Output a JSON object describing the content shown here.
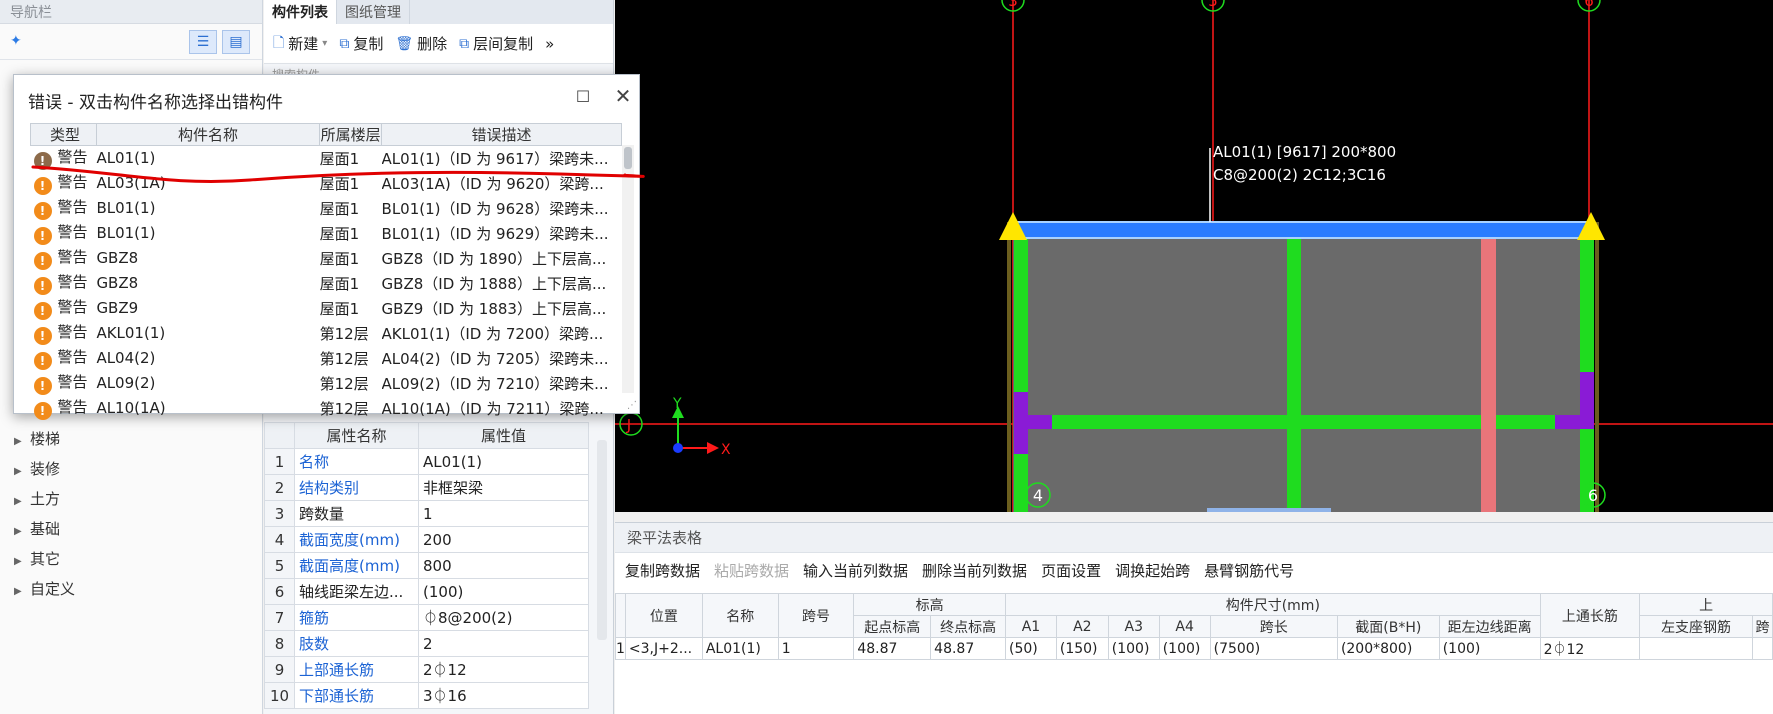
{
  "nav": {
    "title": "导航栏",
    "tree": [
      "楼梯",
      "装修",
      "土方",
      "基础",
      "其它",
      "自定义"
    ]
  },
  "mid": {
    "tabs": [
      "构件列表",
      "图纸管理"
    ],
    "actions": [
      "新建",
      "复制",
      "删除",
      "层间复制"
    ],
    "search_placeholder": "搜索构件...",
    "props_headers": [
      "属性名称",
      "属性值"
    ],
    "props": [
      {
        "no": "1",
        "key": "名称",
        "val": "AL01(1)",
        "blue": true
      },
      {
        "no": "2",
        "key": "结构类别",
        "val": "非框架梁",
        "blue": true
      },
      {
        "no": "3",
        "key": "跨数量",
        "val": "1",
        "blue": false
      },
      {
        "no": "4",
        "key": "截面宽度(mm)",
        "val": "200",
        "blue": true
      },
      {
        "no": "5",
        "key": "截面高度(mm)",
        "val": "800",
        "blue": true
      },
      {
        "no": "6",
        "key": "轴线距梁左边...",
        "val": "(100)",
        "blue": false
      },
      {
        "no": "7",
        "key": "箍筋",
        "val": "⏀8@200(2)",
        "blue": true
      },
      {
        "no": "8",
        "key": "肢数",
        "val": "2",
        "blue": true
      },
      {
        "no": "9",
        "key": "上部通长筋",
        "val": "2⏀12",
        "blue": true
      },
      {
        "no": "10",
        "key": "下部通长筋",
        "val": "3⏀16",
        "blue": true
      }
    ]
  },
  "dialog": {
    "title": "错误 - 双击构件名称选择出错构件",
    "headers": [
      "类型",
      "构件名称",
      "所属楼层",
      "错误描述"
    ],
    "rows": [
      {
        "type": "警告",
        "name": "AL01(1)",
        "floor": "屋面1",
        "desc": "AL01(1)（ID 为 9617）梁跨未..."
      },
      {
        "type": "警告",
        "name": "AL03(1A)",
        "floor": "屋面1",
        "desc": "AL03(1A)（ID 为 9620）梁跨..."
      },
      {
        "type": "警告",
        "name": "BL01(1)",
        "floor": "屋面1",
        "desc": "BL01(1)（ID 为 9628）梁跨未..."
      },
      {
        "type": "警告",
        "name": "BL01(1)",
        "floor": "屋面1",
        "desc": "BL01(1)（ID 为 9629）梁跨未..."
      },
      {
        "type": "警告",
        "name": "GBZ8",
        "floor": "屋面1",
        "desc": "GBZ8（ID 为 1890）上下层高..."
      },
      {
        "type": "警告",
        "name": "GBZ8",
        "floor": "屋面1",
        "desc": "GBZ8（ID 为 1888）上下层高..."
      },
      {
        "type": "警告",
        "name": "GBZ9",
        "floor": "屋面1",
        "desc": "GBZ9（ID 为 1883）上下层高..."
      },
      {
        "type": "警告",
        "name": "AKL01(1)",
        "floor": "第12层",
        "desc": "AKL01(1)（ID 为 7200）梁跨..."
      },
      {
        "type": "警告",
        "name": "AL04(2)",
        "floor": "第12层",
        "desc": "AL04(2)（ID 为 7205）梁跨未..."
      },
      {
        "type": "警告",
        "name": "AL09(2)",
        "floor": "第12层",
        "desc": "AL09(2)（ID 为 7210）梁跨未..."
      },
      {
        "type": "警告",
        "name": "AL10(1A)",
        "floor": "第12层",
        "desc": "AL10(1A)（ID 为 7211）梁跨..."
      }
    ]
  },
  "cad": {
    "axis_labels": [
      "3",
      "5",
      "6",
      "J",
      "4",
      "6"
    ],
    "annotation_line1": "AL01(1) [9617] 200*800",
    "annotation_line2": "C8@200(2) 2C12;3C16",
    "ucs_y": "Y",
    "ucs_x": "X"
  },
  "beam": {
    "title": "梁平法表格",
    "tools": [
      "复制跨数据",
      "粘贴跨数据",
      "输入当前列数据",
      "删除当前列数据",
      "页面设置",
      "调换起始跨",
      "悬臂钢筋代号"
    ],
    "disabled_tool": "粘贴跨数据",
    "head_top": [
      "位置",
      "名称",
      "跨号",
      "标高",
      "构件尺寸(mm)",
      "上通长筋",
      "上"
    ],
    "head_sub": [
      "起点标高",
      "终点标高",
      "A1",
      "A2",
      "A3",
      "A4",
      "跨长",
      "截面(B*H)",
      "距左边线距离",
      "左支座钢筋",
      "跨"
    ],
    "row": {
      "idx": "1",
      "pos": "<3,J+2...",
      "name": "AL01(1)",
      "span": "1",
      "h1": "48.87",
      "h2": "48.87",
      "a1": "(50)",
      "a2": "(150)",
      "a3": "(100)",
      "a4": "(100)",
      "len": "(7500)",
      "sec": "(200*800)",
      "dist": "(100)",
      "top": "2⏀12"
    }
  },
  "colors": {
    "beam_blue": "#2a7cff",
    "beam_green": "#1fdc1f",
    "column_purple": "#8a1bd6",
    "column_pink": "#e9757a",
    "axis_red": "#ff1a1a",
    "warn_orange": "#f28b1a",
    "annotation_red": "#e00000"
  }
}
